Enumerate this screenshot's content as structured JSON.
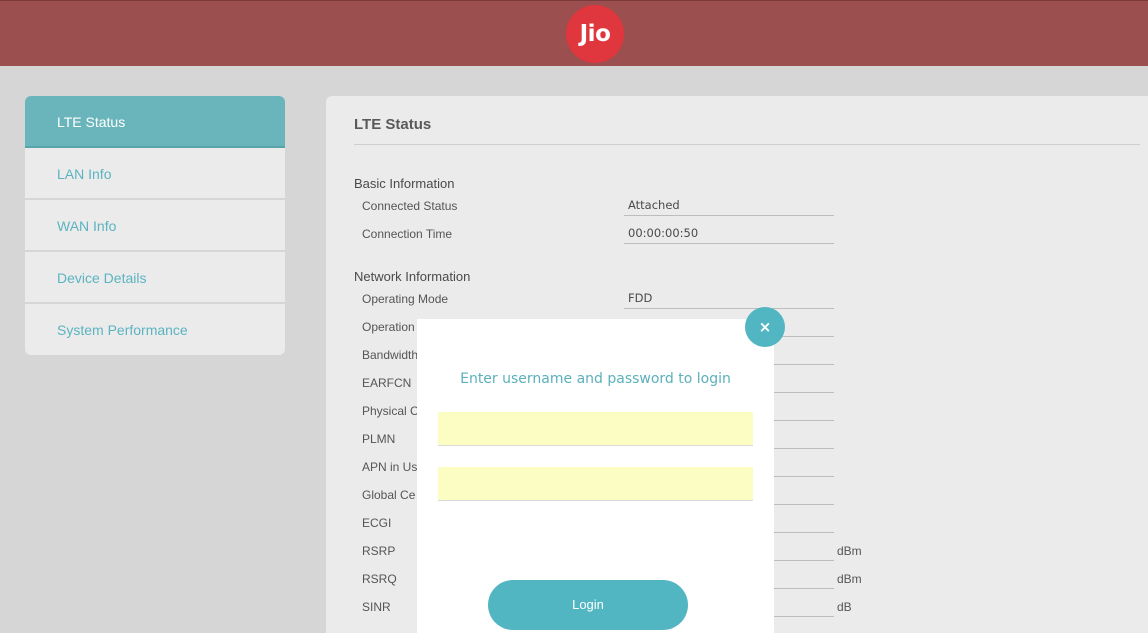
{
  "header": {
    "logo_text": "Jio",
    "background": "#9b4f4f",
    "logo_color": "#e0363d"
  },
  "sidebar": {
    "items": [
      {
        "label": "LTE Status",
        "active": true
      },
      {
        "label": "LAN Info"
      },
      {
        "label": "WAN Info"
      },
      {
        "label": "Device Details"
      },
      {
        "label": "System Performance"
      }
    ]
  },
  "panel": {
    "title": "LTE Status",
    "basic": {
      "heading": "Basic Information",
      "connected_status": {
        "label": "Connected Status",
        "value": "Attached"
      },
      "connection_time": {
        "label": "Connection Time",
        "value": "00:00:00:50"
      }
    },
    "network": {
      "heading": "Network Information",
      "operating_mode": {
        "label": "Operating Mode",
        "value": "FDD"
      },
      "operation_band": {
        "label": "Operation B"
      },
      "bandwidth": {
        "label": "Bandwidth"
      },
      "earfcn": {
        "label": "EARFCN"
      },
      "physical_cell": {
        "label": "Physical C"
      },
      "plmn": {
        "label": "PLMN"
      },
      "apn": {
        "label": "APN in Us"
      },
      "global_cell": {
        "label": "Global Ce"
      },
      "ecgi": {
        "label": "ECGI"
      },
      "rsrp": {
        "label": "RSRP",
        "unit": "dBm"
      },
      "rsrq": {
        "label": "RSRQ",
        "unit": "dBm"
      },
      "sinr": {
        "label": "SINR",
        "unit": "dB"
      }
    }
  },
  "login_modal": {
    "title": "Enter username and password to login",
    "username_value": "",
    "password_value": "",
    "login_label": "Login",
    "close_label": "×",
    "accent": "#52b6c2",
    "input_background": "#fbfdc3"
  }
}
